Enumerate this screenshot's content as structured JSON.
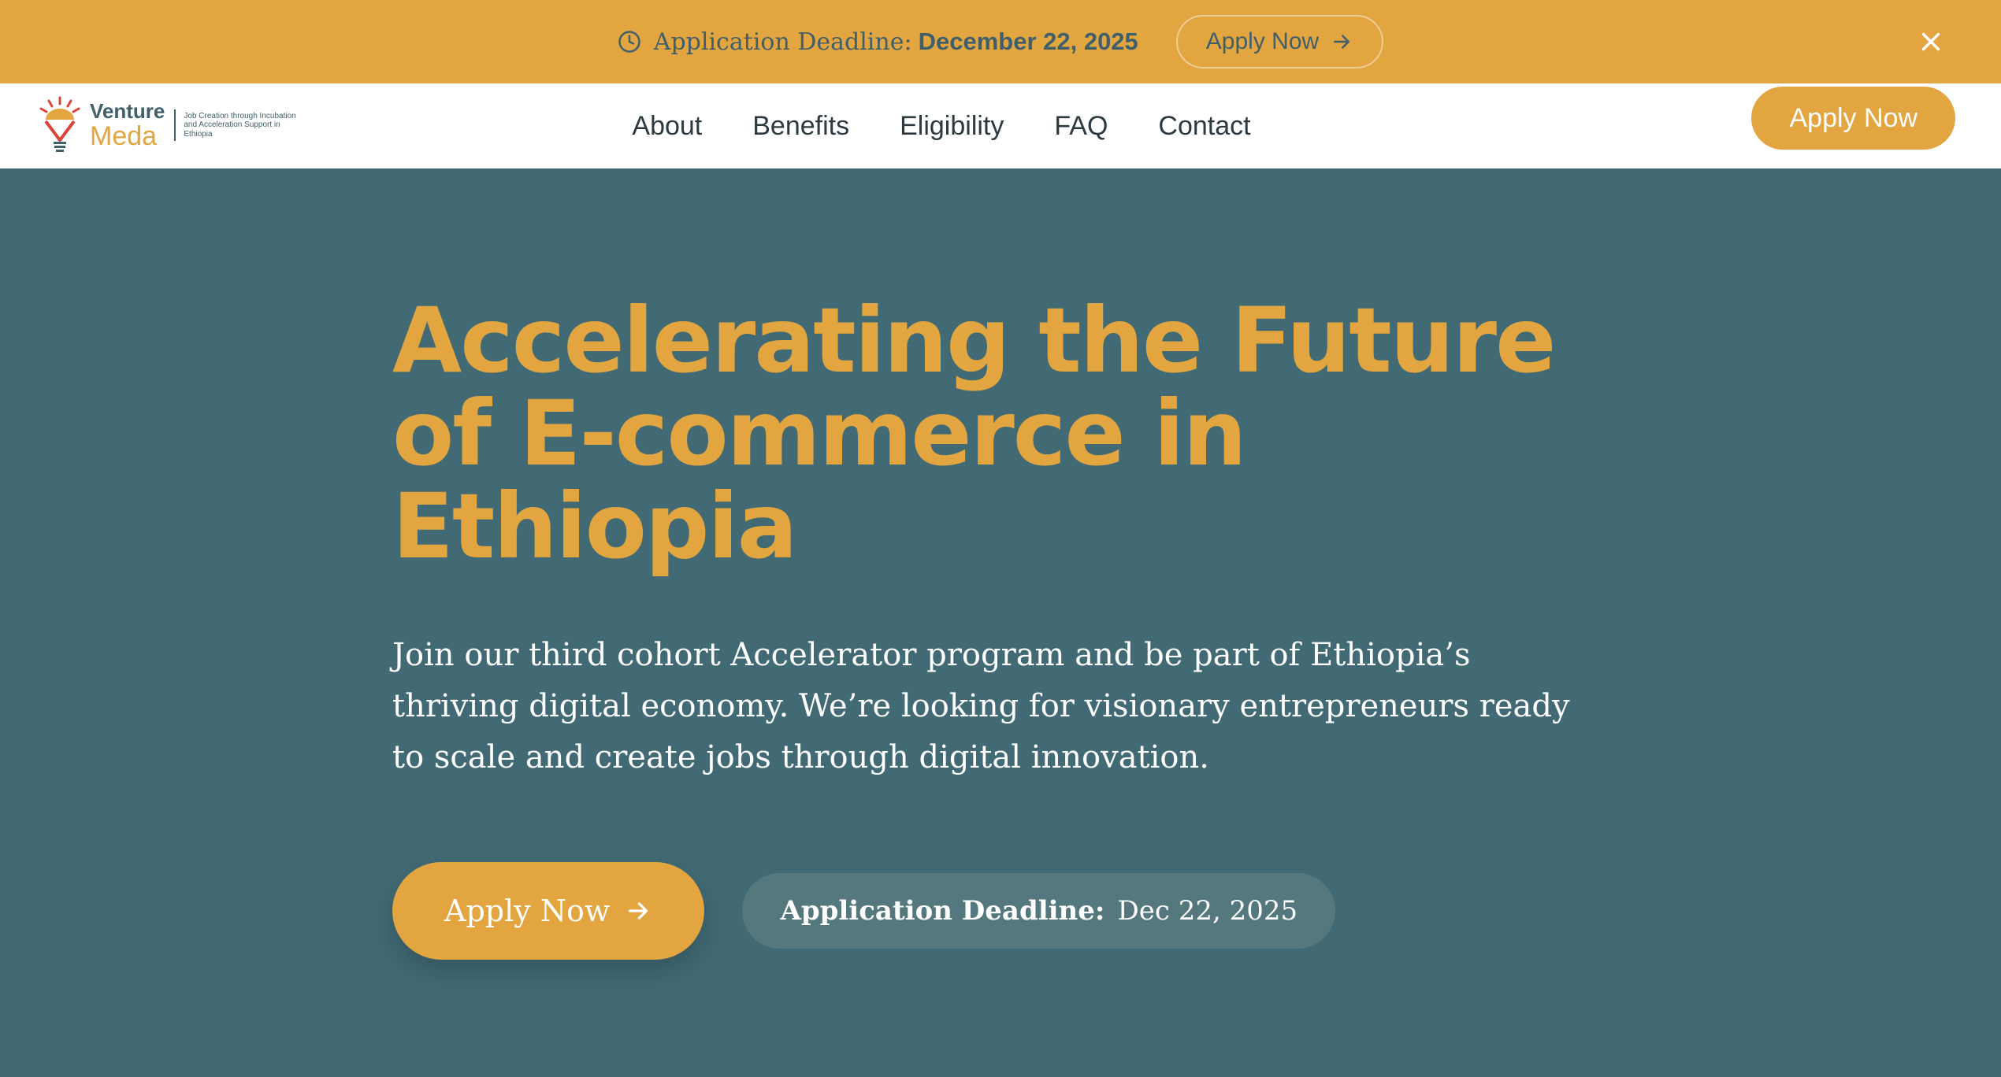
{
  "announcement": {
    "label": "Application Deadline:",
    "date": "December 22, 2025",
    "button_label": "Apply Now",
    "icon": "clock-icon",
    "close_icon": "close-icon"
  },
  "navbar": {
    "logo": {
      "word1": "Venture",
      "word2": "Meda",
      "tagline": "Job Creation through Incubation and Acceleration Support in Ethiopia"
    },
    "links": [
      "About",
      "Benefits",
      "Eligibility",
      "FAQ",
      "Contact"
    ],
    "apply_label": "Apply Now"
  },
  "hero": {
    "title": "Accelerating the Future of E-commerce in Ethiopia",
    "subtitle": "Join our third cohort Accelerator program and be part of Ethiopia’s thriving digital economy. We’re looking for visionary entrepreneurs ready to scale and create jobs through digital innovation.",
    "apply_label": "Apply Now",
    "deadline_label": "Application Deadline:",
    "deadline_date": "Dec 22, 2025"
  },
  "colors": {
    "accent": "#e2a53f",
    "hero_bg": "#416a74",
    "text_dark": "#3f5f6a",
    "white": "#ffffff"
  }
}
